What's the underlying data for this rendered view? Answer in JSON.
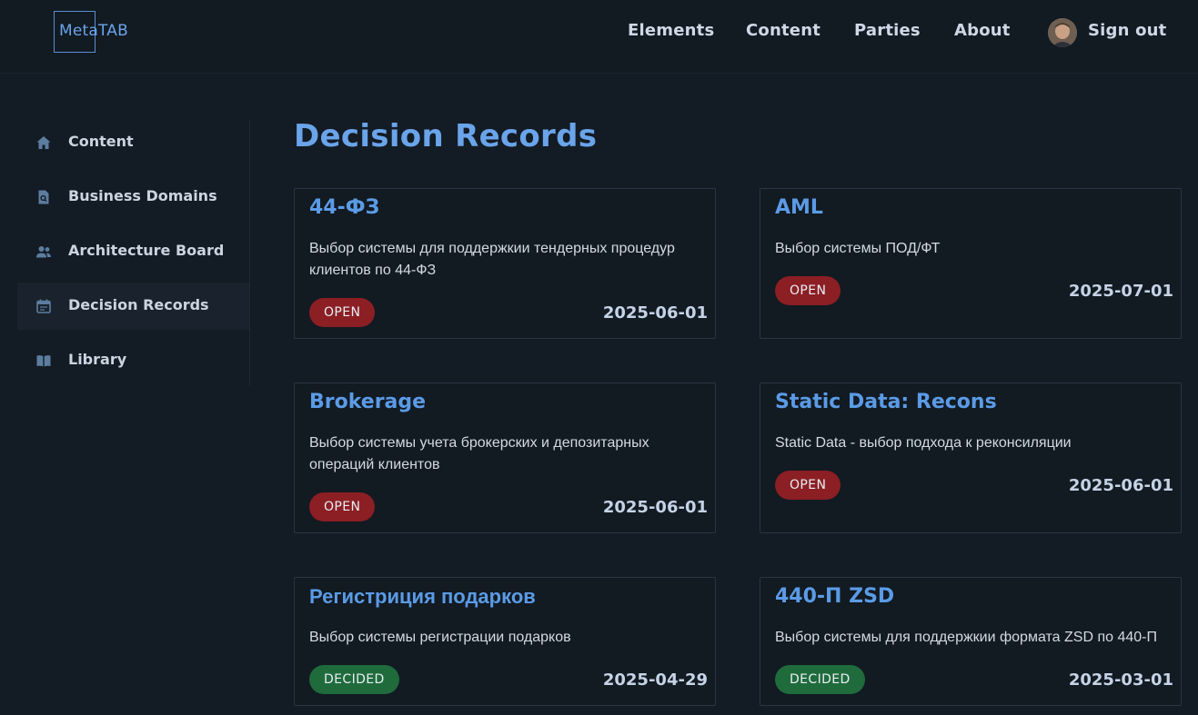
{
  "header": {
    "logo_text": "MetaTAB",
    "nav": [
      {
        "label": "Elements"
      },
      {
        "label": "Content"
      },
      {
        "label": "Parties"
      },
      {
        "label": "About"
      }
    ],
    "sign_out_label": "Sign out"
  },
  "sidebar": {
    "items": [
      {
        "label": "Content",
        "icon": "home-icon"
      },
      {
        "label": "Business Domains",
        "icon": "document-search-icon"
      },
      {
        "label": "Architecture Board",
        "icon": "users-icon"
      },
      {
        "label": "Decision Records",
        "icon": "calendar-icon",
        "active": true
      },
      {
        "label": "Library",
        "icon": "book-icon"
      }
    ]
  },
  "main": {
    "title": "Decision Records",
    "cards": [
      {
        "title": "44-ФЗ",
        "description": "Выбор системы для поддержкии тендерных процедур клиентов по 44-ФЗ",
        "status": "OPEN",
        "date": "2025-06-01"
      },
      {
        "title": "AML",
        "description": "Выбор системы ПОД/ФТ",
        "status": "OPEN",
        "date": "2025-07-01"
      },
      {
        "title": "Brokerage",
        "description": "Выбор системы учета брокерских и депозитарных операций клиентов",
        "status": "OPEN",
        "date": "2025-06-01"
      },
      {
        "title": "Static Data: Recons",
        "description": "Static Data - выбор подхода к реконсиляции",
        "status": "OPEN",
        "date": "2025-06-01"
      },
      {
        "title": "Регистриция подарков",
        "description": "Выбор системы регистрации подарков",
        "status": "DECIDED",
        "date": "2025-04-29"
      },
      {
        "title": "440-П ZSD",
        "description": "Выбор системы для поддержкии формата ZSD по 440-П",
        "status": "DECIDED",
        "date": "2025-03-01"
      }
    ]
  },
  "colors": {
    "background": "#131b24",
    "accent": "#6aa4ea",
    "status_open": "#8b1f24",
    "status_decided": "#1f6b3c"
  }
}
